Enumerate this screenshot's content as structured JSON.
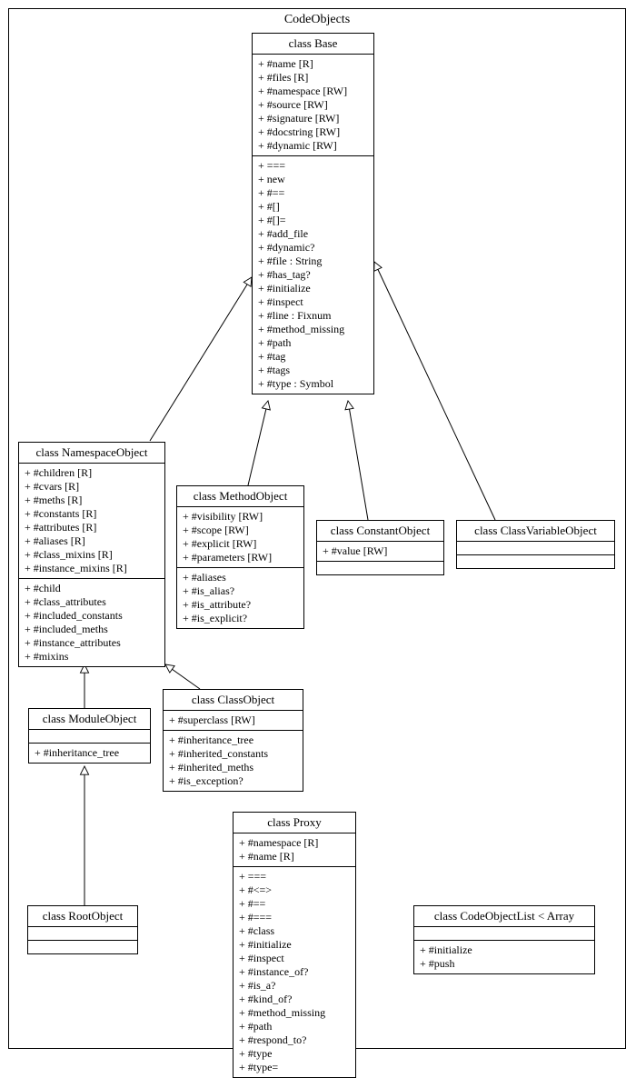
{
  "package_title": "CodeObjects",
  "classes": {
    "base": {
      "title": "class Base",
      "attrs": [
        "+ #name [R]",
        "+ #files [R]",
        "+ #namespace [RW]",
        "+ #source [RW]",
        "+ #signature [RW]",
        "+ #docstring [RW]",
        "+ #dynamic [RW]"
      ],
      "ops": [
        "+ ===",
        "+ new",
        "+ #==",
        "+ #[]",
        "+ #[]=",
        "+ #add_file",
        "+ #dynamic?",
        "+ #file : String",
        "+ #has_tag?",
        "+ #initialize",
        "+ #inspect",
        "+ #line : Fixnum",
        "+ #method_missing",
        "+ #path",
        "+ #tag",
        "+ #tags",
        "+ #type : Symbol"
      ]
    },
    "namespaceObject": {
      "title": "class NamespaceObject",
      "attrs": [
        "+ #children [R]",
        "+ #cvars [R]",
        "+ #meths [R]",
        "+ #constants [R]",
        "+ #attributes [R]",
        "+ #aliases [R]",
        "+ #class_mixins [R]",
        "+ #instance_mixins [R]"
      ],
      "ops": [
        "+ #child",
        "+ #class_attributes",
        "+ #included_constants",
        "+ #included_meths",
        "+ #instance_attributes",
        "+ #mixins"
      ]
    },
    "methodObject": {
      "title": "class MethodObject",
      "attrs": [
        "+ #visibility [RW]",
        "+ #scope [RW]",
        "+ #explicit [RW]",
        "+ #parameters [RW]"
      ],
      "ops": [
        "+ #aliases",
        "+ #is_alias?",
        "+ #is_attribute?",
        "+ #is_explicit?"
      ]
    },
    "constantObject": {
      "title": "class ConstantObject",
      "attrs": [
        "+ #value [RW]"
      ]
    },
    "classVariableObject": {
      "title": "class ClassVariableObject"
    },
    "moduleObject": {
      "title": "class ModuleObject",
      "ops": [
        "+ #inheritance_tree"
      ]
    },
    "classObject": {
      "title": "class ClassObject",
      "attrs": [
        "+ #superclass [RW]"
      ],
      "ops": [
        "+ #inheritance_tree",
        "+ #inherited_constants",
        "+ #inherited_meths",
        "+ #is_exception?"
      ]
    },
    "rootObject": {
      "title": "class RootObject"
    },
    "proxy": {
      "title": "class Proxy",
      "attrs": [
        "+ #namespace [R]",
        "+ #name [R]"
      ],
      "ops": [
        "+ ===",
        "+ #<=>",
        "+ #==",
        "+ #===",
        "+ #class",
        "+ #initialize",
        "+ #inspect",
        "+ #instance_of?",
        "+ #is_a?",
        "+ #kind_of?",
        "+ #method_missing",
        "+ #path",
        "+ #respond_to?",
        "+ #type",
        "+ #type="
      ]
    },
    "codeObjectList": {
      "title": "class CodeObjectList < Array",
      "ops": [
        "+ #initialize",
        "+ #push"
      ]
    }
  }
}
